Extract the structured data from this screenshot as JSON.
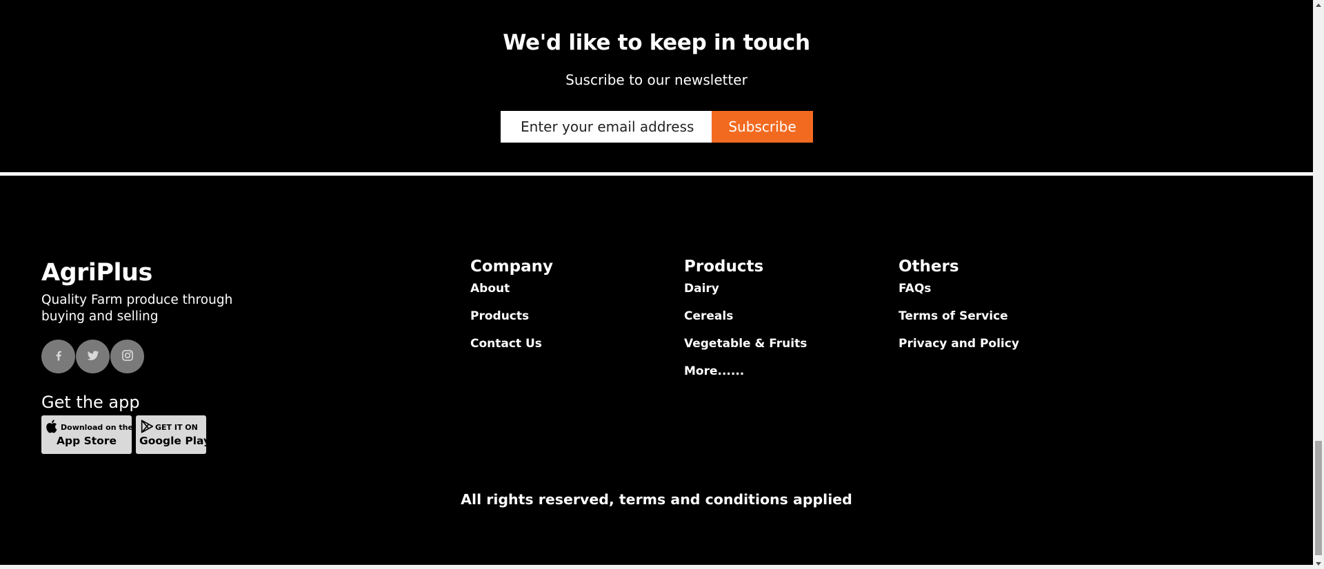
{
  "newsletter": {
    "title": "We'd like to keep in touch",
    "subtitle": "Suscribe to our newsletter",
    "email_placeholder": "Enter your email address",
    "subscribe_label": "Subscribe",
    "accent_color": "#f26a20"
  },
  "brand": {
    "name": "AgriPlus",
    "tagline": "Quality Farm produce through buying and selling",
    "socials": [
      {
        "icon": "facebook-icon"
      },
      {
        "icon": "twitter-icon"
      },
      {
        "icon": "instagram-icon"
      }
    ],
    "get_app_label": "Get the app",
    "app_store": {
      "top": "Download on the",
      "bottom": "App Store",
      "icon": "apple-icon"
    },
    "google_play": {
      "top": "GET IT ON",
      "bottom": "Google Play",
      "icon": "play-icon"
    }
  },
  "columns": [
    {
      "title": "Company",
      "links": [
        "About",
        "Products",
        "Contact Us"
      ]
    },
    {
      "title": "Products",
      "links": [
        "Dairy",
        "Cereals",
        "Vegetable & Fruits",
        "More......"
      ]
    },
    {
      "title": "Others",
      "links": [
        "FAQs",
        "Terms of Service",
        "Privacy and Policy"
      ]
    }
  ],
  "copyright": "All rights reserved, terms and conditions applied"
}
